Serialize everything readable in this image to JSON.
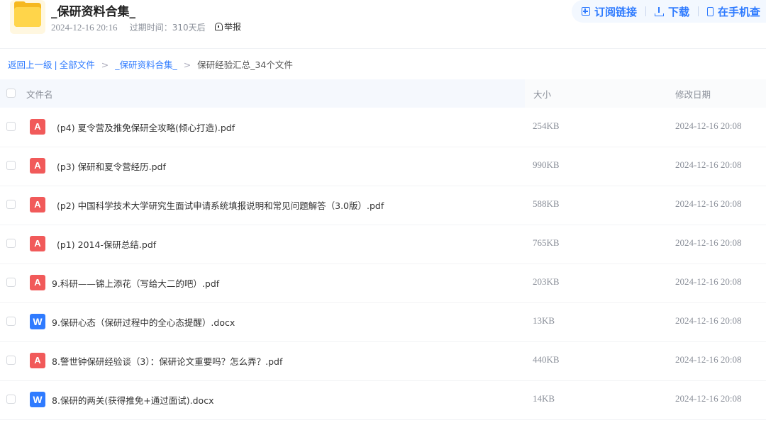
{
  "share": {
    "title": "_保研资料合集_",
    "date": "2024-12-16 20:16",
    "expire": "过期时间：310天后",
    "report": "举报"
  },
  "actions": {
    "subscribe": "订阅链接",
    "download": "下载",
    "phone": "在手机查"
  },
  "breadcrumb": {
    "back": "返回上一级",
    "all_files": "全部文件",
    "folder": "_保研资料合集_",
    "current": "保研经验汇总_34个文件",
    "separator": ">",
    "bar": "|"
  },
  "table": {
    "columns": {
      "name": "文件名",
      "size": "大小",
      "date": "修改日期"
    },
    "rows": [
      {
        "type": "pdf",
        "name": "(p4) 夏令营及推免保研全攻略(倾心打造).pdf",
        "size": "254KB",
        "date": "2024-12-16 20:08"
      },
      {
        "type": "pdf",
        "name": "(p3) 保研和夏令营经历.pdf",
        "size": "990KB",
        "date": "2024-12-16 20:08"
      },
      {
        "type": "pdf",
        "name": "(p2) 中国科学技术大学研究生面试申请系统填报说明和常见问题解答（3.0版）.pdf",
        "size": "588KB",
        "date": "2024-12-16 20:08"
      },
      {
        "type": "pdf",
        "name": "(p1) 2014-保研总结.pdf",
        "size": "765KB",
        "date": "2024-12-16 20:08"
      },
      {
        "type": "pdf",
        "name": "9.科研——锦上添花（写给大二的吧）.pdf",
        "size": "203KB",
        "date": "2024-12-16 20:08"
      },
      {
        "type": "docx",
        "name": "9.保研心态（保研过程中的全心态提醒）.docx",
        "size": "13KB",
        "date": "2024-12-16 20:08"
      },
      {
        "type": "pdf",
        "name": "8.警世钟保研经验谈（3）：保研论文重要吗？怎么弄？.pdf",
        "size": "440KB",
        "date": "2024-12-16 20:08"
      },
      {
        "type": "docx",
        "name": "8.保研的两关(获得推免+通过面试).docx",
        "size": "14KB",
        "date": "2024-12-16 20:08"
      }
    ]
  },
  "icons": {
    "folder": "folder-icon",
    "pdf": "pdf-file-icon",
    "docx": "word-file-icon",
    "subscribe": "subscribe-icon",
    "download": "download-icon",
    "phone": "phone-icon",
    "report": "report-icon"
  },
  "colors": {
    "accent": "#2f7bff",
    "pdf": "#f15a5a",
    "folder": "#ffd54a",
    "muted": "#8a8f99"
  }
}
